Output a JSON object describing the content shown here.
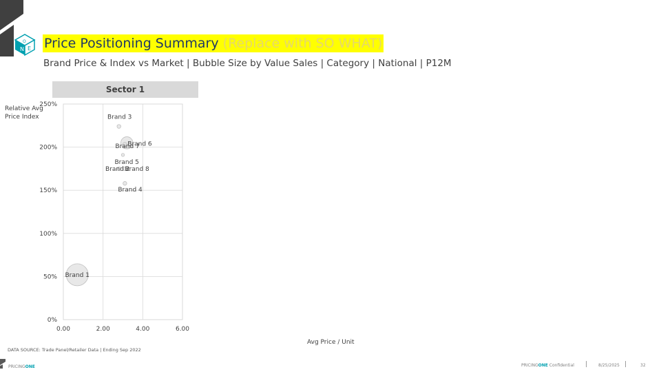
{
  "header": {
    "title": "Price Positioning Summary",
    "title_suffix": "(Replace with SO WHAT)",
    "subtitle": "Brand Price & Index vs Market | Bubble Size by Value Sales | Category | National | P12M"
  },
  "chart_data": {
    "type": "scatter",
    "title": "Sector 1",
    "xlabel": "Avg Price / Unit",
    "ylabel": "Relative Avg Price Index",
    "xlim": [
      0,
      6
    ],
    "ylim": [
      0,
      250
    ],
    "x_ticks": [
      "0.00",
      "2.00",
      "4.00",
      "6.00"
    ],
    "y_ticks": [
      "0%",
      "50%",
      "100%",
      "150%",
      "200%",
      "250%"
    ],
    "grid": true,
    "points": [
      {
        "label": "Brand 1",
        "x": 0.7,
        "y": 52,
        "size": 100
      },
      {
        "label": "Brand 2",
        "x": 2.8,
        "y": 175,
        "size": 3
      },
      {
        "label": "Brand 3",
        "x": 2.8,
        "y": 224,
        "size": 3
      },
      {
        "label": "Brand 4",
        "x": 3.1,
        "y": 158,
        "size": 3
      },
      {
        "label": "Brand 5",
        "x": 3.0,
        "y": 191,
        "size": 2
      },
      {
        "label": "Brand 6",
        "x": 3.2,
        "y": 205,
        "size": 30
      },
      {
        "label": "Brand 7",
        "x": 3.1,
        "y": 203,
        "size": 4
      },
      {
        "label": "Brand 8",
        "x": 3.1,
        "y": 175,
        "size": 3
      }
    ],
    "bubble_color": "#d9d9d9"
  },
  "footer": {
    "source": "DATA SOURCE: Trade Panel/Retailer Data | Ending Sep 2022",
    "brand_prefix": "PRICING",
    "brand_suffix": "ONE",
    "conf_prefix": "PRICING",
    "conf_mid": "ONE",
    "conf_suffix": " Confidential",
    "date": "8/25/2025",
    "page": "32"
  }
}
